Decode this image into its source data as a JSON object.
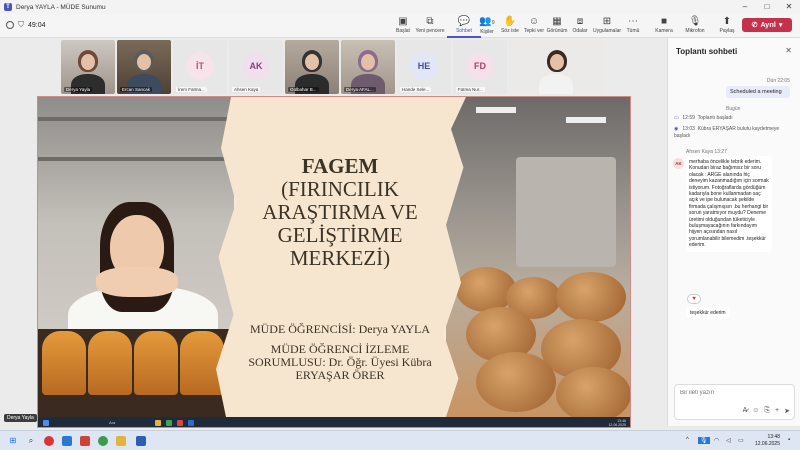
{
  "window": {
    "title": "Derya YAYLA - MÜDE Sunumu"
  },
  "toolbar": {
    "timer": "49:04",
    "items": [
      {
        "label": "Başlat",
        "icon": "start-icon"
      },
      {
        "label": "Yeni pencere",
        "icon": "new-window-icon"
      },
      {
        "label": "Sohbet",
        "icon": "chat-icon"
      },
      {
        "label": "Kişiler",
        "icon": "people-icon",
        "count": "9"
      },
      {
        "label": "Söz iste",
        "icon": "raise-hand-icon"
      },
      {
        "label": "Tepki ver",
        "icon": "react-icon"
      },
      {
        "label": "Görünüm",
        "icon": "view-icon"
      },
      {
        "label": "Odalar",
        "icon": "rooms-icon"
      },
      {
        "label": "Uygulamalar",
        "icon": "apps-icon"
      },
      {
        "label": "Tümü",
        "icon": "more-icon"
      },
      {
        "label": "Kamera",
        "icon": "camera-icon"
      },
      {
        "label": "Mikrofon",
        "icon": "mic-icon"
      },
      {
        "label": "Paylaş",
        "icon": "share-icon"
      }
    ],
    "leave_label": "Ayrıl"
  },
  "participants": [
    {
      "name": "Derya Yayla",
      "type": "photo"
    },
    {
      "name": "Ercan Sancak",
      "type": "photo"
    },
    {
      "name": "İrem Fatma...",
      "initials": "İT",
      "type": "initials",
      "color": "#f7e4ea",
      "text": "#c0506a"
    },
    {
      "name": "Ahsen Kaya",
      "initials": "AK",
      "type": "initials",
      "color": "#f0e0ee",
      "text": "#8a3d7d"
    },
    {
      "name": "Gülbahar B...",
      "type": "photo"
    },
    {
      "name": "Derya AFAL...",
      "type": "photo"
    },
    {
      "name": "Hande Sele...",
      "initials": "HE",
      "type": "initials",
      "color": "#e2e6f6",
      "text": "#3f51a3"
    },
    {
      "name": "Fatma Nur...",
      "initials": "FD",
      "type": "initials",
      "color": "#f6e0ea",
      "text": "#b0406a"
    },
    {
      "name": "",
      "type": "photo-big"
    }
  ],
  "slide": {
    "title_1": "FAGEM",
    "title_2": "(FIRINCILIK",
    "title_3": "ARAŞTIRMA VE",
    "title_4": "GELİŞTİRME",
    "title_5": "MERKEZİ)",
    "student": "MÜDE ÖĞRENCİSİ: Derya YAYLA",
    "resp_1": "MÜDE ÖĞRENCİ İZLEME",
    "resp_2": "SORUMLUSU: Dr. Öğr. Üyesi Kübra",
    "resp_3": "ERYAŞAR ÖRER"
  },
  "inner_taskbar": {
    "search": "Ara",
    "time": "13:46",
    "date": "12.06.2025"
  },
  "presenter_badge": "Derya Yayla",
  "chat": {
    "header": "Toplantı sohbeti",
    "msg_me_meta": "Dün 22:05",
    "msg_me": "Scheduled a meeting",
    "day": "Bugün",
    "events": [
      {
        "time": "12:59",
        "text": "Toplantı başladı"
      },
      {
        "time": "13:03",
        "text": "Kübra ERYAŞAR bulutu kaydetmeye başladı"
      }
    ],
    "sender_meta": "Ahsen Kaya 13:27",
    "sender_initials": "AK",
    "message": "merhaba öncelikle tebrik ederim. Konudan biraz bağımsız bir soru olacak : ARGE alanında hiç deneyim kazanmadığım için sormak istiyorum. Fotoğraflarda gördüğüm kadarıyla bone kullanmadan saç açık ve ipe bulunacak şekilde firmada çalışmışsın .bu herhangi bir sorun yaratmıyor muydu? Deneme üretimi olduğundan tüketiciyle buluşmayacağının farkındayım hijyen açısından nasıl yorumlanabilir bilemedim .teşekkür ederim.",
    "reaction": "♥",
    "message_2": "teşekkür ederim",
    "input_placeholder": "Bir ileti yazın"
  },
  "taskbar": {
    "time": "13:48",
    "date": "12.06.2025"
  }
}
